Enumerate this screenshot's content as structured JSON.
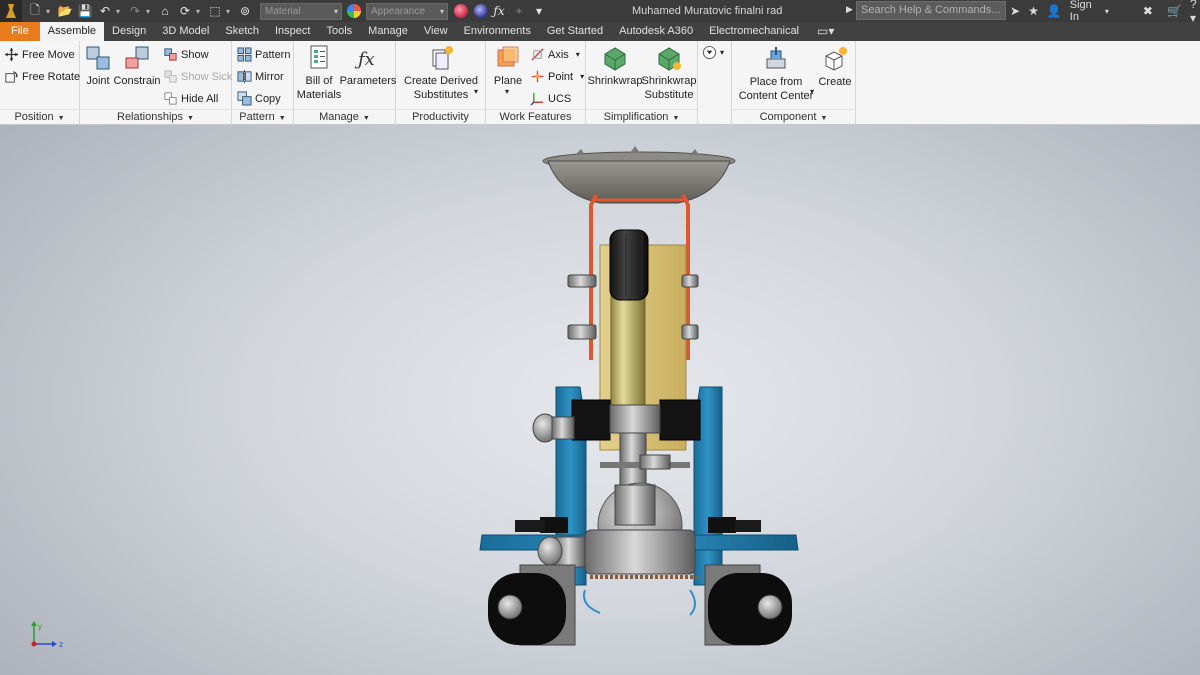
{
  "titlebar": {
    "document_title": "Muhamed Muratovic finalni rad",
    "material_select": "Material",
    "appearance_select": "Appearance",
    "help_search_placeholder": "Search Help & Commands...",
    "sign_in": "Sign In"
  },
  "tabs": [
    {
      "label": "File"
    },
    {
      "label": "Assemble"
    },
    {
      "label": "Design"
    },
    {
      "label": "3D Model"
    },
    {
      "label": "Sketch"
    },
    {
      "label": "Inspect"
    },
    {
      "label": "Tools"
    },
    {
      "label": "Manage"
    },
    {
      "label": "View"
    },
    {
      "label": "Environments"
    },
    {
      "label": "Get Started"
    },
    {
      "label": "Autodesk A360"
    },
    {
      "label": "Electromechanical"
    }
  ],
  "ribbon": {
    "position": {
      "label": "Position",
      "free_move": "Free Move",
      "free_rotate": "Free Rotate"
    },
    "relationships": {
      "label": "Relationships",
      "joint": "Joint",
      "constrain": "Constrain",
      "show": "Show",
      "show_sick": "Show Sick",
      "hide_all": "Hide All"
    },
    "pattern": {
      "label": "Pattern",
      "pattern": "Pattern",
      "mirror": "Mirror",
      "copy": "Copy"
    },
    "manage": {
      "label": "Manage",
      "bom_line1": "Bill of",
      "bom_line2": "Materials",
      "parameters": "Parameters"
    },
    "productivity": {
      "label": "Productivity",
      "cds_line1": "Create Derived",
      "cds_line2": "Substitutes"
    },
    "work_features": {
      "label": "Work Features",
      "plane": "Plane",
      "axis": "Axis",
      "point": "Point",
      "ucs": "UCS"
    },
    "simplification": {
      "label": "Simplification",
      "shrinkwrap": "Shrinkwrap",
      "sws_line1": "Shrinkwrap",
      "sws_line2": "Substitute"
    },
    "component": {
      "label": "Component",
      "pfcc_line1": "Place from",
      "pfcc_line2": "Content Center",
      "create": "Create"
    }
  },
  "colors": {
    "file_tab": "#e87b1c",
    "titlebar": "#3b3b3b",
    "ribbon": "#f5f5f5",
    "frame_blue": "#1f7fb0",
    "bracket_orange": "#e0582a",
    "plate_yellow": "#d9c37c"
  },
  "triad": {
    "y": "y",
    "z": "z"
  }
}
